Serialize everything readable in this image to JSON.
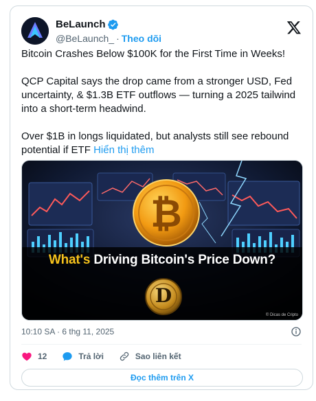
{
  "author": {
    "display_name": "BeLaunch",
    "handle": "@BeLaunch_",
    "separator": "·",
    "follow_label": "Theo dõi"
  },
  "post": {
    "paragraphs": [
      "Bitcoin Crashes Below $100K for the First Time in Weeks!",
      "QCP Capital says the drop came from a stronger USD, Fed uncertainty, & $1.3B ETF outflows — turning a 2025 tailwind into a short-term headwind.",
      "Over $1B in longs liquidated, but analysts still see rebound potential if ETF"
    ],
    "show_more_label": "Hiển thị thêm"
  },
  "media": {
    "title_accent": "What's",
    "title_rest": " Driving Bitcoin's Price Down?",
    "watermark": "© Dicas de Cripto",
    "coin_letter": "D"
  },
  "meta": {
    "timestamp": "10:10 SA · 6 thg 11, 2025"
  },
  "actions": {
    "like_count": "12",
    "reply_label": "Trả lời",
    "copy_link_label": "Sao liên kết"
  },
  "read_more_label": "Đọc thêm trên X",
  "colors": {
    "accent": "#1d9bf0",
    "like": "#f91880",
    "text": "#0f1419",
    "muted": "#536471",
    "gold": "#f6c21c"
  },
  "icons": [
    "verified-badge-icon",
    "x-logo-icon",
    "info-icon",
    "heart-icon",
    "reply-icon",
    "link-icon"
  ]
}
